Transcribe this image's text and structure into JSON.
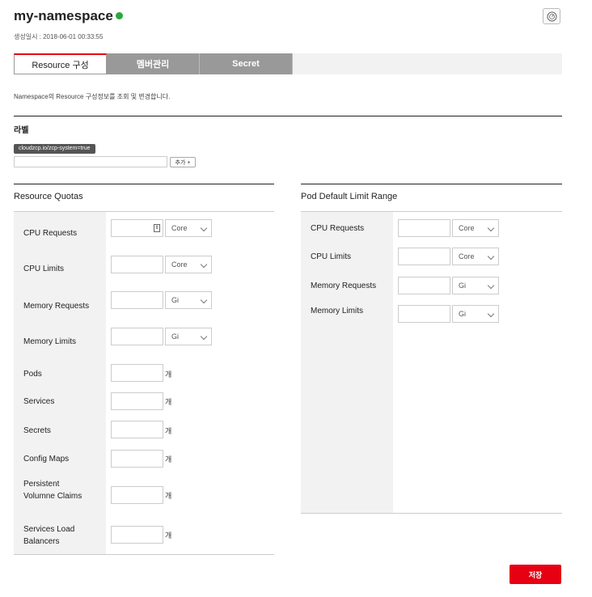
{
  "header": {
    "title": "my-namespace",
    "created_label": "생성일시 : 2018-06-01 00:33:55",
    "status_color": "#2aa83a"
  },
  "tabs": [
    {
      "label": "Resource 구성",
      "active": true
    },
    {
      "label": "멤버관리",
      "active": false
    },
    {
      "label": "Secret",
      "active": false
    }
  ],
  "description": "Namespace의 Resource 구성정보를 조회 및 변경합니다.",
  "labels": {
    "title": "라벨",
    "tag": "cloudzcp.io/zcp-system=true",
    "input_value": "",
    "add_button": "추가 +"
  },
  "resource_quotas": {
    "title": "Resource Quotas",
    "rows": [
      {
        "label": "CPU Requests",
        "value": "",
        "unit": "Core"
      },
      {
        "label": "CPU Limits",
        "value": "",
        "unit": "Core"
      },
      {
        "label": "Memory Requests",
        "value": "",
        "unit": "Gi"
      },
      {
        "label": "Memory Limits",
        "value": "",
        "unit": "Gi"
      },
      {
        "label": "Pods",
        "value": "",
        "unit": "개"
      },
      {
        "label": "Services",
        "value": "",
        "unit": "개"
      },
      {
        "label": "Secrets",
        "value": "",
        "unit": "개"
      },
      {
        "label": "Config Maps",
        "value": "",
        "unit": "개"
      },
      {
        "label": "Persistent Volumne Claims",
        "value": "",
        "unit": "개"
      },
      {
        "label": "Services Load Balancers",
        "value": "",
        "unit": "개"
      }
    ]
  },
  "limit_range": {
    "title": "Pod Default Limit Range",
    "rows": [
      {
        "label": "CPU Requests",
        "value": "",
        "unit": "Core"
      },
      {
        "label": "CPU Limits",
        "value": "",
        "unit": "Core"
      },
      {
        "label": "Memory Requests",
        "value": "",
        "unit": "Gi"
      },
      {
        "label": "Memory Limits",
        "value": "",
        "unit": "Gi"
      }
    ]
  },
  "save_button": "저장",
  "accent_color": "#e60012"
}
